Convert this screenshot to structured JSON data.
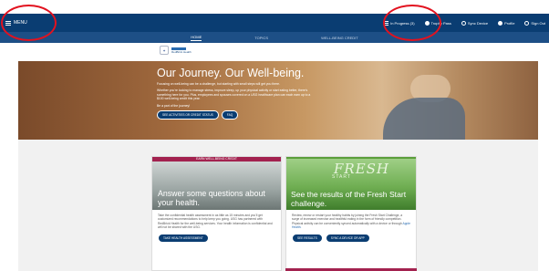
{
  "topbar": {
    "menu_label": "MENU",
    "items": [
      {
        "label": "In Progress (3)",
        "icon": "list-icon"
      },
      {
        "label": "Trophy Pass",
        "icon": "medal-icon"
      },
      {
        "label": "Sync Device",
        "icon": "sync-icon"
      },
      {
        "label": "Profile",
        "icon": "user-icon"
      },
      {
        "label": "Sign Out",
        "icon": "sign-out-icon"
      }
    ]
  },
  "subnav": {
    "tabs": [
      "HOME",
      "TOPICS",
      "WELL-BEING CREDIT"
    ],
    "active_index": 0
  },
  "logo": {
    "text": "RedBrick Health"
  },
  "hero": {
    "title": "Our Journey. Our Well-being.",
    "para1": "Focusing on well-being can be a challenge, but starting with small steps will get you there.",
    "para2": "Whether you're looking to manage stress, improve sleep, up your physical activity or start eating better, there's something here for you. Plus, employees and spouses covered on a USG healthcare plan can each earn up to a $100 well-being credit this year.",
    "para3": "Be a part of the journey!",
    "button_primary": "SEE ACTIVITIES OR CREDIT STATUS",
    "button_secondary": "FAQ"
  },
  "card_assessment": {
    "band_label": "EARN WELL-BEING CREDIT",
    "title": "Answer some questions about your health.",
    "body": "Take the confidential health assessment in as little as 15 minutes and you'll get customized recommendations to help keep you going. USG has partnered with RedBrick Health for the well-being services. Your health information is confidential and will not be shared with the USG.",
    "button": "TAKE HEALTH ASSESSMENT"
  },
  "card_fresh_start": {
    "image_title": "FRESH",
    "image_subtitle": "START",
    "title": "See the results of the Fresh Start challenge.",
    "body": "Review, renew or restart your healthy habits by joining the Fresh Start Challenge, a surge of increased exercise and healthful eating in the form of friendly competition. Physical activity can be conveniently synced automatically with a device or through",
    "body_link": "Apple Health.",
    "button1": "SEE RESULTS",
    "button2": "SYNC A DEVICE OR APP"
  },
  "colors": {
    "topbar": "#0a3d72",
    "subnav": "#1d4f86",
    "accent_maroon": "#a3224f",
    "accent_green": "#5b9e3a",
    "annotation_red": "#e2121f"
  }
}
